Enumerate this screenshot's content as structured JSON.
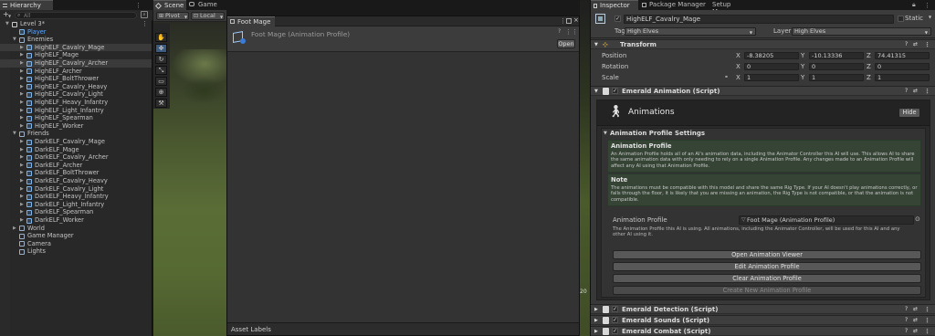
{
  "hierarchy": {
    "tab": "Hierarchy",
    "add": "+",
    "search_placeholder": "All",
    "items": [
      {
        "label": "Level 3*",
        "depth": 0,
        "arrow": "▼",
        "kind": "scene"
      },
      {
        "label": "Player",
        "depth": 1,
        "arrow": "",
        "kind": "prefab",
        "color": "#5ca8ff"
      },
      {
        "label": "Enemies",
        "depth": 1,
        "arrow": "▼",
        "kind": "obj"
      },
      {
        "label": "HighELF_Cavalry_Mage",
        "depth": 2,
        "arrow": "▶",
        "kind": "prefab",
        "selected": true
      },
      {
        "label": "HighELF_Mage",
        "depth": 2,
        "arrow": "▶",
        "kind": "prefab"
      },
      {
        "label": "HighELF_Cavalry_Archer",
        "depth": 2,
        "arrow": "▶",
        "kind": "prefab",
        "selected": true
      },
      {
        "label": "HighELF_Archer",
        "depth": 2,
        "arrow": "▶",
        "kind": "prefab"
      },
      {
        "label": "HighELF_BoltThrower",
        "depth": 2,
        "arrow": "▶",
        "kind": "prefab"
      },
      {
        "label": "HighELF_Cavalry_Heavy",
        "depth": 2,
        "arrow": "▶",
        "kind": "prefab"
      },
      {
        "label": "HighELF_Cavalry_Light",
        "depth": 2,
        "arrow": "▶",
        "kind": "prefab"
      },
      {
        "label": "HighELF_Heavy_Infantry",
        "depth": 2,
        "arrow": "▶",
        "kind": "prefab"
      },
      {
        "label": "HighELF_Light_Infantry",
        "depth": 2,
        "arrow": "▶",
        "kind": "prefab"
      },
      {
        "label": "HighELF_Spearman",
        "depth": 2,
        "arrow": "▶",
        "kind": "prefab"
      },
      {
        "label": "HighELF_Worker",
        "depth": 2,
        "arrow": "▶",
        "kind": "prefab"
      },
      {
        "label": "Friends",
        "depth": 1,
        "arrow": "▼",
        "kind": "obj"
      },
      {
        "label": "DarkELF_Cavalry_Mage",
        "depth": 2,
        "arrow": "▶",
        "kind": "prefab"
      },
      {
        "label": "DarkELF_Mage",
        "depth": 2,
        "arrow": "▶",
        "kind": "prefab"
      },
      {
        "label": "DarkELF_Cavalry_Archer",
        "depth": 2,
        "arrow": "▶",
        "kind": "prefab"
      },
      {
        "label": "DarkELF_Archer",
        "depth": 2,
        "arrow": "▶",
        "kind": "prefab"
      },
      {
        "label": "DarkELF_BoltThrower",
        "depth": 2,
        "arrow": "▶",
        "kind": "prefab"
      },
      {
        "label": "DarkELF_Cavalry_Heavy",
        "depth": 2,
        "arrow": "▶",
        "kind": "prefab"
      },
      {
        "label": "DarkELF_Cavalry_Light",
        "depth": 2,
        "arrow": "▶",
        "kind": "prefab"
      },
      {
        "label": "DarkELF_Heavy_Infantry",
        "depth": 2,
        "arrow": "▶",
        "kind": "prefab"
      },
      {
        "label": "DarkELF_Light_Infantry",
        "depth": 2,
        "arrow": "▶",
        "kind": "prefab"
      },
      {
        "label": "DarkELF_Spearman",
        "depth": 2,
        "arrow": "▶",
        "kind": "prefab"
      },
      {
        "label": "DarkELF_Worker",
        "depth": 2,
        "arrow": "▶",
        "kind": "prefab"
      },
      {
        "label": "World",
        "depth": 1,
        "arrow": "▶",
        "kind": "obj"
      },
      {
        "label": "Game Manager",
        "depth": 1,
        "arrow": "",
        "kind": "obj"
      },
      {
        "label": "Camera",
        "depth": 1,
        "arrow": "",
        "kind": "obj"
      },
      {
        "label": "Lights",
        "depth": 1,
        "arrow": "",
        "kind": "obj"
      }
    ]
  },
  "scene": {
    "tab_scene": "Scene",
    "tab_game": "Game",
    "pivot": "Pivot",
    "local": "Local",
    "tools": [
      "hand-tool-icon",
      "move-tool-icon",
      "rotate-tool-icon",
      "scale-tool-icon",
      "rect-tool-icon",
      "transform-tool-icon",
      "custom-tool-icon"
    ],
    "edge_label": "20"
  },
  "asset_window": {
    "tab": "Foot Mage",
    "title": "Foot Mage (Animation Profile)",
    "open": "Open",
    "footer": "Asset Labels"
  },
  "inspector": {
    "tabs": {
      "inspector": "Inspector",
      "package_manager": "Package Manager",
      "setup_manager": "Setup Manager"
    },
    "object_name": "HighELF_Cavalry_Mage",
    "static_label": "Static",
    "tag_label": "Tag",
    "tag_value": "High Elves",
    "layer_label": "Layer",
    "layer_value": "High Elves",
    "transform": {
      "title": "Transform",
      "position_label": "Position",
      "rotation_label": "Rotation",
      "scale_label": "Scale",
      "position": {
        "x": "-8.38205",
        "y": "-10.13336",
        "z": "74.41315"
      },
      "rotation": {
        "x": "0",
        "y": "0",
        "z": "0"
      },
      "scale": {
        "x": "1",
        "y": "1",
        "z": "1"
      }
    },
    "emerald_animation": {
      "title": "Emerald Animation (Script)",
      "header_title": "Animations",
      "hide": "Hide",
      "settings_title": "Animation Profile Settings",
      "help1_title": "Animation Profile",
      "help1_text": "An Animation Profile holds all of an AI's animation data, including the Animator Controller this AI will use. This allows AI to share the same animation data with only needing to rely on a single Animation Profile. Any changes made to an Animation Profile will affect any AI using that Animation Profile.",
      "help2_title": "Note",
      "help2_text": "The animations must be compatible with this model and share the same Rig Type. If your AI doesn't play animations correctly, or falls through the floor, it is likely that you are missing an animation, the Rig Type is not compatible, or that the animation is not compatible.",
      "profile_label": "Animation Profile",
      "profile_value": "Foot Mage (Animation Profile)",
      "profile_desc": "The Animation Profile this AI is using. All animations, including the Animator Controller, will be used for this AI and any other AI using it.",
      "buttons": [
        "Open Animation Viewer",
        "Edit Animation Profile",
        "Clear Animation Profile"
      ],
      "disabled_button": "Create New Animation Profile"
    },
    "components": [
      "Emerald Detection (Script)",
      "Emerald Sounds (Script)",
      "Emerald Combat (Script)"
    ]
  }
}
